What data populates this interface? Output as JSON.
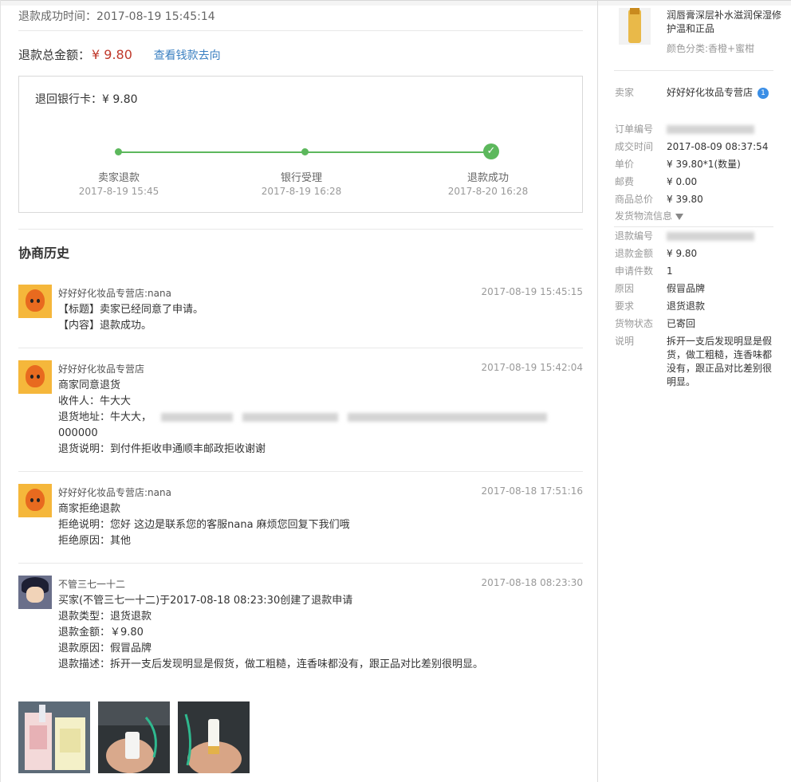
{
  "header": {
    "refund_time": "退款成功时间：2017-08-19 15:45:14",
    "total_label": "退款总金额：",
    "total_amount": "¥ 9.80",
    "trace_link": "查看钱款去向"
  },
  "bank_panel": {
    "bank_label": "退回银行卡：¥ 9.80",
    "steps": [
      {
        "label": "卖家退款",
        "date": "2017-8-19 15:45"
      },
      {
        "label": "银行受理",
        "date": "2017-8-19 16:28"
      },
      {
        "label": "退款成功",
        "date": "2017-8-20 16:28"
      }
    ],
    "check_icon": "✓"
  },
  "history": {
    "title": "协商历史",
    "entries": [
      {
        "name": "好好好化妆品专营店:nana",
        "time": "2017-08-19 15:45:15",
        "lines": [
          "【标题】卖家已经同意了申请。",
          "【内容】退款成功。"
        ]
      },
      {
        "name": "好好好化妆品专营店",
        "time": "2017-08-19 15:42:04",
        "lines": [
          "商家同意退货",
          "收件人：牛大大",
          "退货地址：牛大大，",
          "000000",
          "退货说明：到付件拒收申通顺丰邮政拒收谢谢"
        ]
      },
      {
        "name": "好好好化妆品专营店:nana",
        "time": "2017-08-18 17:51:16",
        "lines": [
          "商家拒绝退款",
          "拒绝说明：您好 这边是联系您的客服nana 麻烦您回复下我们哦",
          "拒绝原因：其他"
        ]
      },
      {
        "name": "不管三七一十二",
        "time": "2017-08-18 08:23:30",
        "lines": [
          "买家(不管三七一十二)于2017-08-18 08:23:30创建了退款申请",
          "退款类型：退货退款",
          "退款金额：￥9.80",
          "退款原因：假冒品牌",
          "退款描述：拆开一支后发现明显是假货，做工粗糙，连香味都没有，跟正品对比差别很明显。"
        ]
      }
    ]
  },
  "sidebar": {
    "product_title": "润唇膏深层补水滋润保湿修护温和正品",
    "product_color": "颜色分类:香橙+蜜柑",
    "order_fields": [
      {
        "k": "卖家",
        "v": "好好好化妆品专营店"
      },
      {
        "k": "订单编号",
        "v": ""
      },
      {
        "k": "成交时间",
        "v": "2017-08-09 08:37:54"
      },
      {
        "k": "单价",
        "v": "¥ 39.80*1(数量)"
      },
      {
        "k": "邮费",
        "v": "¥ 0.00"
      },
      {
        "k": "商品总价",
        "v": "¥ 39.80"
      }
    ],
    "logistics_label": "发货物流信息",
    "refund_fields": [
      {
        "k": "退款编号",
        "v": ""
      },
      {
        "k": "退款金额",
        "v": "¥ 9.80"
      },
      {
        "k": "申请件数",
        "v": "1"
      },
      {
        "k": "原因",
        "v": "假冒品牌"
      },
      {
        "k": "要求",
        "v": "退货退款"
      },
      {
        "k": "货物状态",
        "v": "已寄回"
      },
      {
        "k": "说明",
        "v": "拆开一支后发现明显是假货，做工粗糙，连香味都没有，跟正品对比差别很明显。"
      }
    ],
    "seller_badge": "1"
  }
}
